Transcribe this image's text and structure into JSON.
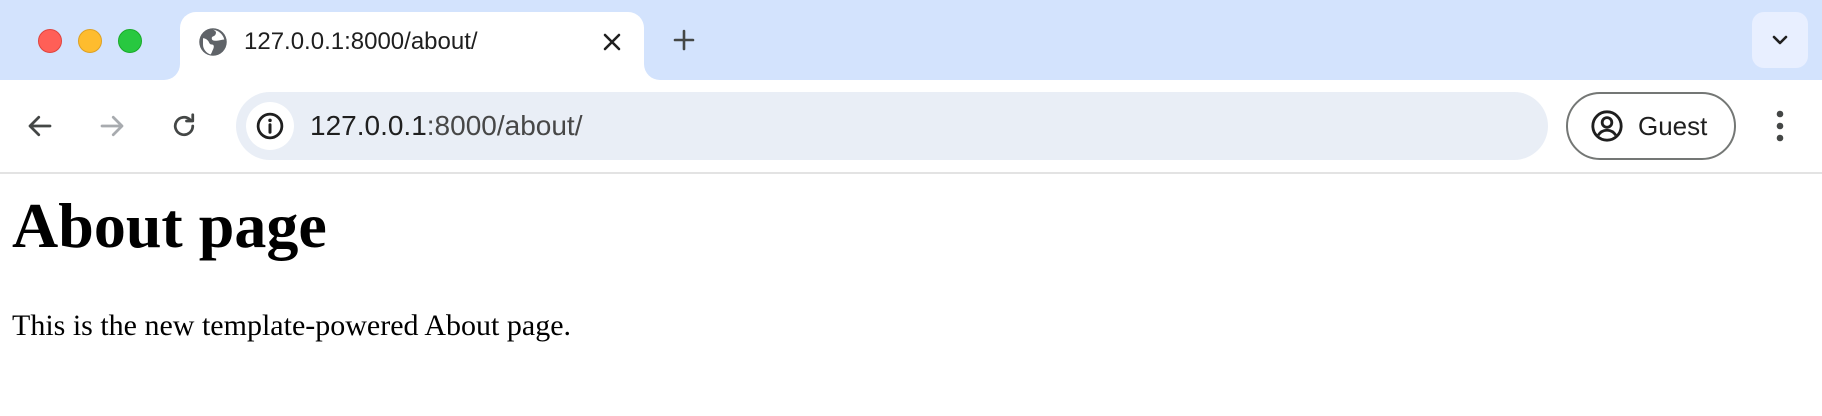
{
  "window": {
    "controls": [
      "close",
      "minimize",
      "zoom"
    ],
    "colors": {
      "close": "#ff5f57",
      "minimize": "#febc2e",
      "zoom": "#28c840"
    }
  },
  "tabs": [
    {
      "title": "127.0.0.1:8000/about/",
      "favicon": "globe-icon",
      "active": true
    }
  ],
  "toolbar": {
    "url_host": "127.0.0.1",
    "url_rest": ":8000/about/",
    "profile_label": "Guest"
  },
  "page": {
    "heading": "About page",
    "paragraph": "This is the new template-powered About page."
  },
  "theme": {
    "tabstrip_bg": "#d3e3fd",
    "omnibox_bg": "#e9eef6"
  }
}
